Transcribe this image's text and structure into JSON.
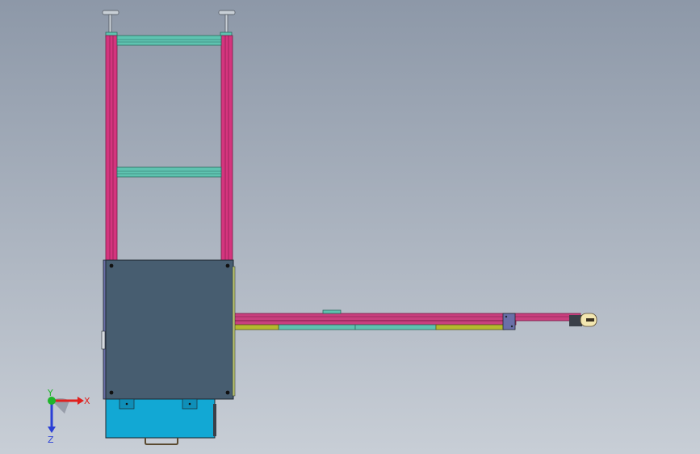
{
  "viewport": {
    "background_top": "#8d98a8",
    "background_bottom": "#c8ced6"
  },
  "colors": {
    "upright_post": "#d4357e",
    "upright_post_edge": "#7a1a45",
    "cross_rail": "#5ec3b0",
    "cross_rail_edge": "#2a6b5e",
    "cabinet_panel": "#475d70",
    "cabinet_edge": "#1e2830",
    "base_box": "#12a8d4",
    "arm_rail": "#c8407e",
    "arm_lower_green": "#5ec3b0",
    "arm_lower_olive": "#b4b92e",
    "gripper_head": "#f2e6b0",
    "mount_plate": "#6a6fa8",
    "leveling_foot": "#c8cfd6"
  },
  "axis_triad": {
    "x_label": "X",
    "y_label": "Y",
    "z_label": "Z",
    "x_color": "#e0201e",
    "y_color": "#1fb52a",
    "z_color": "#2a3fd6"
  }
}
